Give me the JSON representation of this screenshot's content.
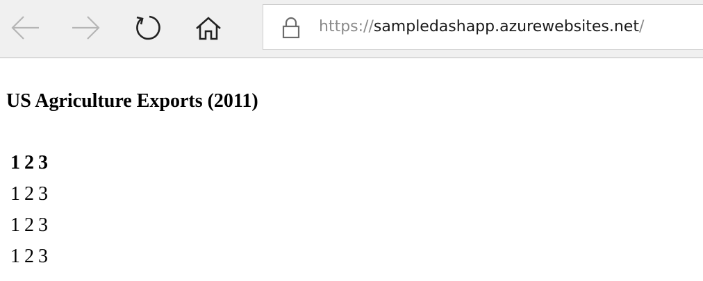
{
  "browser": {
    "url_scheme": "https://",
    "url_host": "sampledashapp.azurewebsites.net",
    "url_trailing": "/"
  },
  "page": {
    "title": "US Agriculture Exports (2011)",
    "table": {
      "headers": [
        "1",
        "2",
        "3"
      ],
      "rows": [
        [
          "1",
          "2",
          "3"
        ],
        [
          "1",
          "2",
          "3"
        ],
        [
          "1",
          "2",
          "3"
        ]
      ]
    }
  },
  "icons": {
    "back": "arrow-left-icon",
    "forward": "arrow-right-icon",
    "refresh": "refresh-icon",
    "home": "home-icon",
    "lock": "lock-icon"
  }
}
